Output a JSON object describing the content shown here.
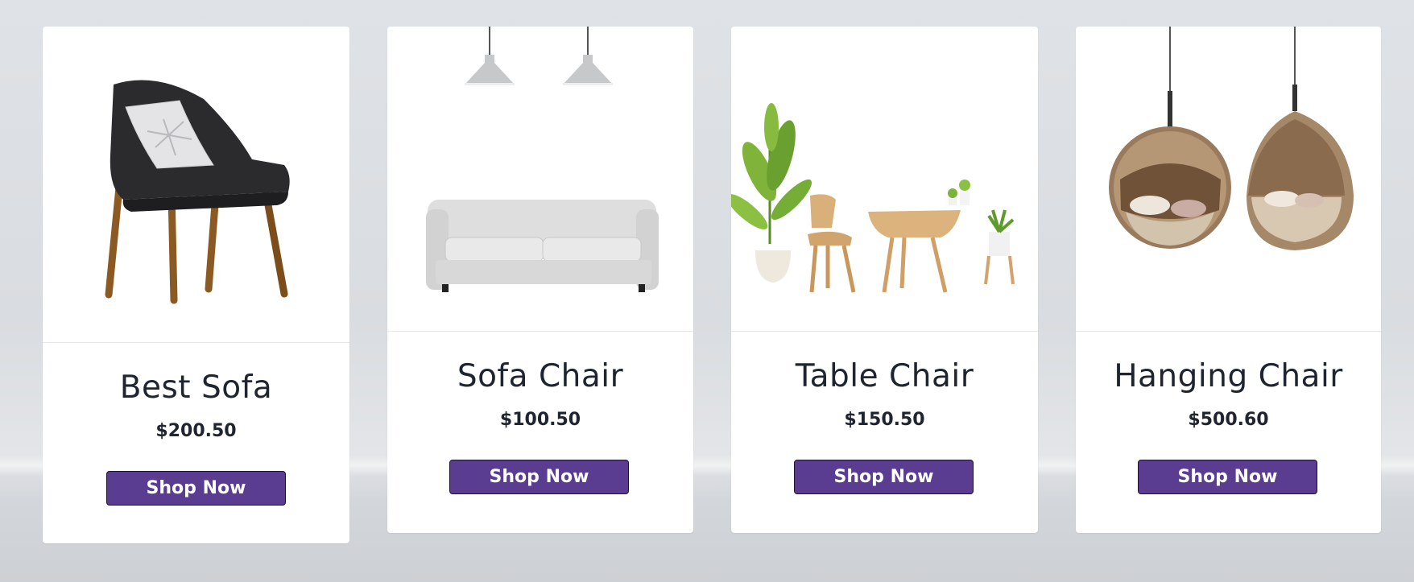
{
  "colors": {
    "button_bg": "#5a3d90",
    "card_bg": "#ffffff",
    "page_bg": "#dcdfe3",
    "text": "#1e2430"
  },
  "products": [
    {
      "name": "Best Sofa",
      "price": "$200.50",
      "button": "Shop Now",
      "image": "black-upholstered-chair-with-pillow"
    },
    {
      "name": "Sofa Chair",
      "price": "$100.50",
      "button": "Shop Now",
      "image": "white-sofa-with-pendant-lamps"
    },
    {
      "name": "Table Chair",
      "price": "$150.50",
      "button": "Shop Now",
      "image": "wooden-table-chair-with-plants"
    },
    {
      "name": "Hanging Chair",
      "price": "$500.60",
      "button": "Shop Now",
      "image": "rattan-hanging-egg-chairs"
    }
  ]
}
